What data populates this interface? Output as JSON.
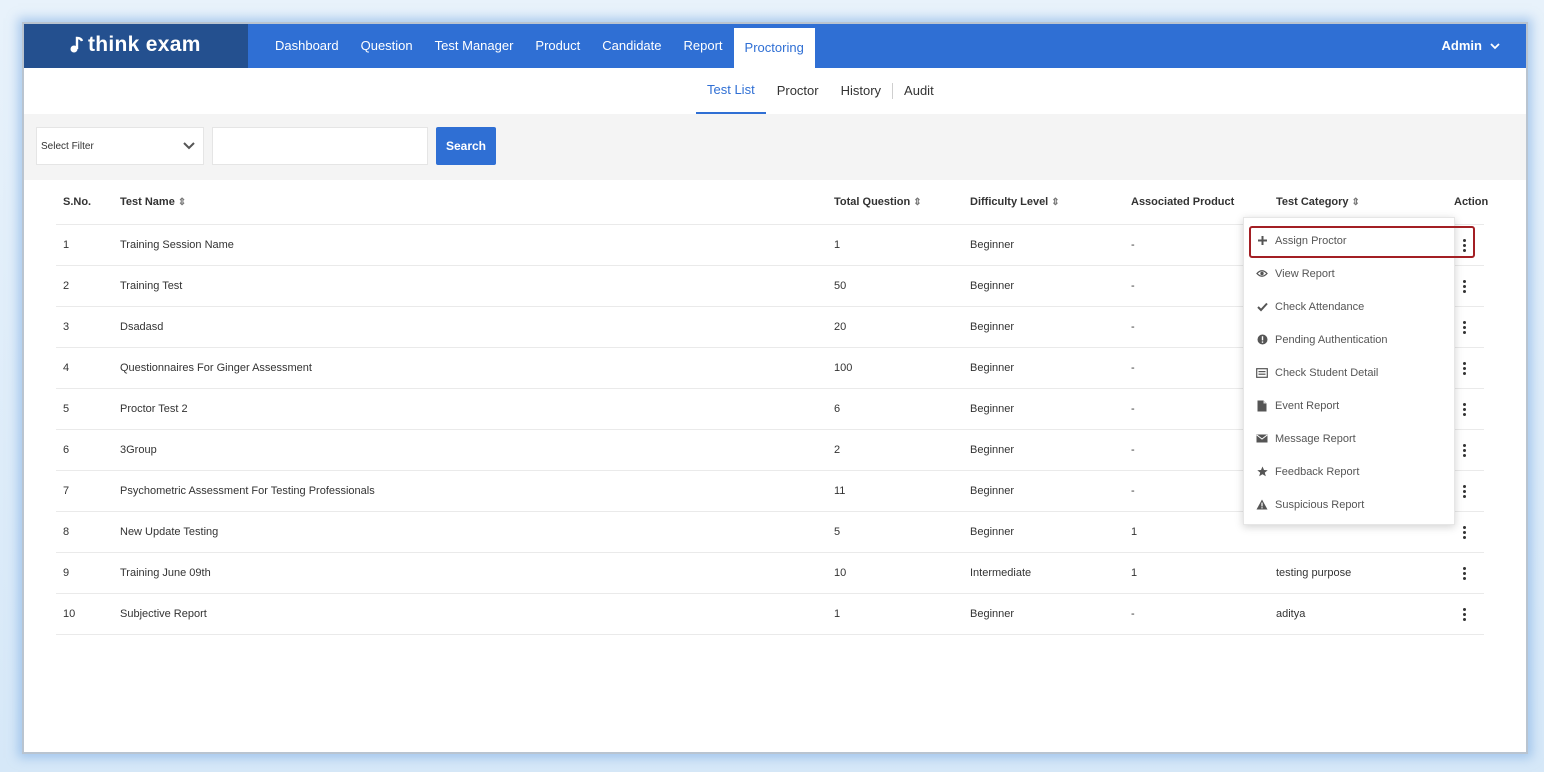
{
  "brand": {
    "logo_text": "think exam"
  },
  "nav": {
    "items": [
      {
        "label": "Dashboard",
        "active": false
      },
      {
        "label": "Question",
        "active": false
      },
      {
        "label": "Test Manager",
        "active": false
      },
      {
        "label": "Product",
        "active": false
      },
      {
        "label": "Candidate",
        "active": false
      },
      {
        "label": "Report",
        "active": false
      },
      {
        "label": "Proctoring",
        "active": true
      }
    ],
    "user_label": "Admin"
  },
  "subtabs": {
    "items": [
      {
        "label": "Test List",
        "active": true
      },
      {
        "label": "Proctor",
        "active": false
      },
      {
        "label": "History",
        "active": false
      },
      {
        "label": "Audit",
        "active": false
      }
    ]
  },
  "filter": {
    "select_value": "Select Filter",
    "search_value": "",
    "search_button": "Search"
  },
  "table": {
    "columns": {
      "sno": "S.No.",
      "test_name": "Test Name",
      "total_question": "Total Question",
      "difficulty": "Difficulty Level",
      "associated_product": "Associated Product",
      "test_category": "Test Category",
      "action": "Action"
    },
    "rows": [
      {
        "sno": "1",
        "name": "Training Session Name",
        "total": "1",
        "level": "Beginner",
        "product": "-",
        "category": ""
      },
      {
        "sno": "2",
        "name": "Training Test",
        "total": "50",
        "level": "Beginner",
        "product": "-",
        "category": ""
      },
      {
        "sno": "3",
        "name": "Dsadasd",
        "total": "20",
        "level": "Beginner",
        "product": "-",
        "category": ""
      },
      {
        "sno": "4",
        "name": "Questionnaires For Ginger Assessment",
        "total": "100",
        "level": "Beginner",
        "product": "-",
        "category": ""
      },
      {
        "sno": "5",
        "name": "Proctor Test 2",
        "total": "6",
        "level": "Beginner",
        "product": "-",
        "category": ""
      },
      {
        "sno": "6",
        "name": "3Group",
        "total": "2",
        "level": "Beginner",
        "product": "-",
        "category": ""
      },
      {
        "sno": "7",
        "name": "Psychometric Assessment For Testing Professionals",
        "total": "11",
        "level": "Beginner",
        "product": "-",
        "category": ""
      },
      {
        "sno": "8",
        "name": "New Update Testing",
        "total": "5",
        "level": "Beginner",
        "product": "1",
        "category": ""
      },
      {
        "sno": "9",
        "name": "Training June 09th",
        "total": "10",
        "level": "Intermediate",
        "product": "1",
        "category": "testing purpose"
      },
      {
        "sno": "10",
        "name": "Subjective Report",
        "total": "1",
        "level": "Beginner",
        "product": "-",
        "category": "aditya"
      }
    ]
  },
  "action_menu": {
    "items": [
      {
        "label": "Assign Proctor",
        "icon": "plus-icon"
      },
      {
        "label": "View Report",
        "icon": "eye-icon"
      },
      {
        "label": "Check Attendance",
        "icon": "check-icon"
      },
      {
        "label": "Pending Authentication",
        "icon": "exclamation-circle-icon"
      },
      {
        "label": "Check Student Detail",
        "icon": "id-card-icon"
      },
      {
        "label": "Event Report",
        "icon": "file-icon"
      },
      {
        "label": "Message Report",
        "icon": "envelope-icon"
      },
      {
        "label": "Feedback Report",
        "icon": "star-icon"
      },
      {
        "label": "Suspicious Report",
        "icon": "warning-icon"
      }
    ]
  },
  "colors": {
    "nav_bg": "#2f6fd4",
    "logo_bg": "#24508f",
    "accent": "#2f6fd4",
    "highlight": "#a31f24"
  }
}
